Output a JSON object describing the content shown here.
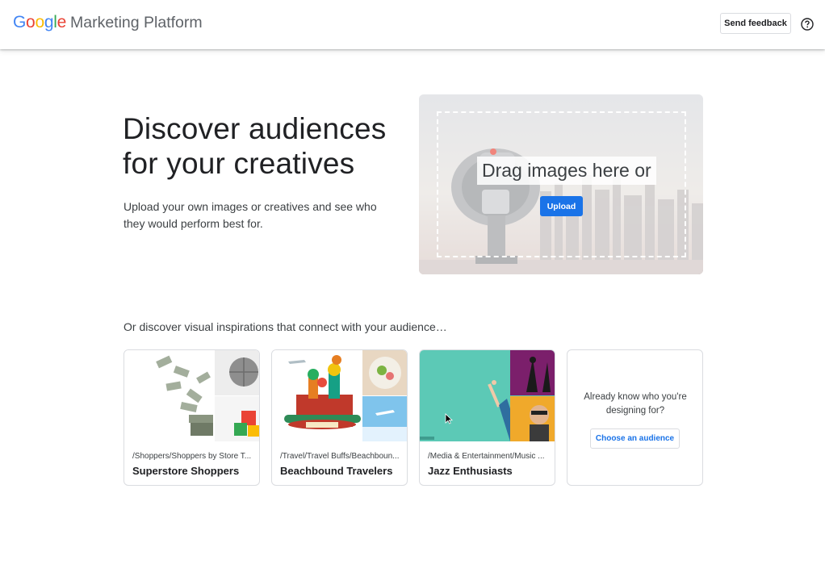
{
  "header": {
    "logo_letters": [
      "G",
      "o",
      "o",
      "g",
      "l",
      "e"
    ],
    "logo_colors": [
      "#4285F4",
      "#EA4335",
      "#FBBC05",
      "#4285F4",
      "#34A853",
      "#EA4335"
    ],
    "product_name": "Marketing Platform",
    "feedback_label": "Send feedback",
    "help_icon": "help-circle-icon"
  },
  "hero": {
    "title_line1": "Discover audiences",
    "title_line2": "for your creatives",
    "description": "Upload your own images or creatives and see who they would perform best for.",
    "drop_text": "Drag images here or",
    "upload_label": "Upload"
  },
  "inspiration": {
    "heading": "Or discover visual inspirations that connect with your audience…",
    "cards": [
      {
        "path": "/Shoppers/Shoppers by Store T...",
        "name": "Superstore Shoppers"
      },
      {
        "path": "/Travel/Travel Buffs/Beachboun...",
        "name": "Beachbound Travelers"
      },
      {
        "path": "/Media & Entertainment/Music ...",
        "name": "Jazz Enthusiasts"
      }
    ],
    "cta": {
      "text": "Already know who you're designing for?",
      "button_label": "Choose an audience"
    }
  },
  "colors": {
    "accent": "#1a73e8",
    "border": "#dadce0",
    "text": "#202124"
  }
}
